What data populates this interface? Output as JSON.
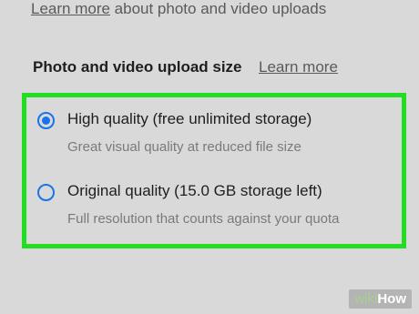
{
  "top": {
    "link_text": "Learn more",
    "rest_text": " about photo and video uploads"
  },
  "section": {
    "title": "Photo and video upload size",
    "learn_more": "Learn more"
  },
  "options": [
    {
      "label": "High quality (free unlimited storage)",
      "description": "Great visual quality at reduced file size",
      "selected": true
    },
    {
      "label": "Original quality (15.0 GB storage left)",
      "description": "Full resolution that counts against your quota",
      "selected": false
    }
  ],
  "colors": {
    "highlight_border": "#22dd22",
    "radio_accent": "#1a73e8",
    "background": "#d9d9d9"
  },
  "watermark": {
    "wiki": "wiki",
    "how": "How"
  }
}
